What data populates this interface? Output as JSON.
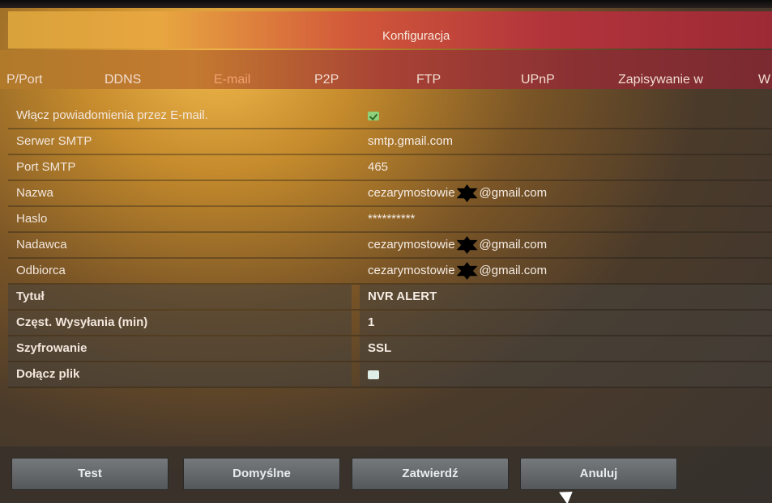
{
  "window": {
    "title": "Konfiguracja"
  },
  "tabs": [
    {
      "label": "P/Port"
    },
    {
      "label": "DDNS"
    },
    {
      "label": "E-mail",
      "active": true
    },
    {
      "label": "P2P"
    },
    {
      "label": "FTP"
    },
    {
      "label": "UPnP"
    },
    {
      "label": "Zapisywanie w"
    },
    {
      "label": "W"
    }
  ],
  "form": {
    "enable_email": {
      "label": "Włącz powiadomienia przez E-mail.",
      "checked": true
    },
    "smtp_server": {
      "label": "Serwer SMTP",
      "value": "smtp.gmail.com"
    },
    "smtp_port": {
      "label": "Port SMTP",
      "value": "465"
    },
    "name": {
      "label": "Nazwa",
      "value_prefix": "cezarymostowie",
      "value_suffix": "@gmail.com"
    },
    "password": {
      "label": "Haslo",
      "value": "**********"
    },
    "sender": {
      "label": "Nadawca",
      "value_prefix": "cezarymostowie",
      "value_suffix": "@gmail.com"
    },
    "recipient": {
      "label": "Odbiorca",
      "value_prefix": "cezarymostowie",
      "value_suffix": "@gmail.com"
    },
    "subject": {
      "label": "Tytuł",
      "value": "NVR ALERT"
    },
    "send_interval": {
      "label": "Częst. Wysyłania (min)",
      "value": "1"
    },
    "encryption": {
      "label": "Szyfrowanie",
      "value": "SSL"
    },
    "attach_file": {
      "label": "Dołącz plik",
      "checked": false
    }
  },
  "buttons": {
    "test": "Test",
    "default": "Domyślne",
    "apply": "Zatwierdź",
    "cancel": "Anuluj"
  },
  "colors": {
    "accent_tab": "#f3a070",
    "checkbox_checked": "#8fd07a",
    "button_face": "#65696c"
  }
}
